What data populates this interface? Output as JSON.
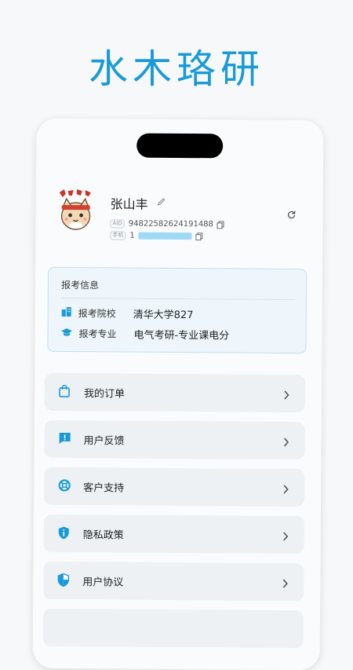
{
  "hero": {
    "title": "水木珞研"
  },
  "profile": {
    "name": "张山丰",
    "aid_tag": "AID",
    "aid": "94822582624191488",
    "phone_tag": "手机",
    "phone_prefix": "1"
  },
  "info_card": {
    "title": "报考信息",
    "rows": [
      {
        "icon": "building-icon",
        "label": "报考院校",
        "value": "清华大学827"
      },
      {
        "icon": "graduation-cap-icon",
        "label": "报考专业",
        "value": "电气考研-专业课电分"
      }
    ]
  },
  "menu": [
    {
      "icon": "shopping-bag-icon",
      "label": "我的订单"
    },
    {
      "icon": "feedback-icon",
      "label": "用户反馈"
    },
    {
      "icon": "lifebuoy-icon",
      "label": "客户支持"
    },
    {
      "icon": "info-shield-icon",
      "label": "隐私政策"
    },
    {
      "icon": "half-shield-icon",
      "label": "用户协议"
    }
  ],
  "colors": {
    "accent": "#1a9ad6",
    "card_bg": "#eef6fb",
    "menu_bg": "#eef1f4"
  }
}
